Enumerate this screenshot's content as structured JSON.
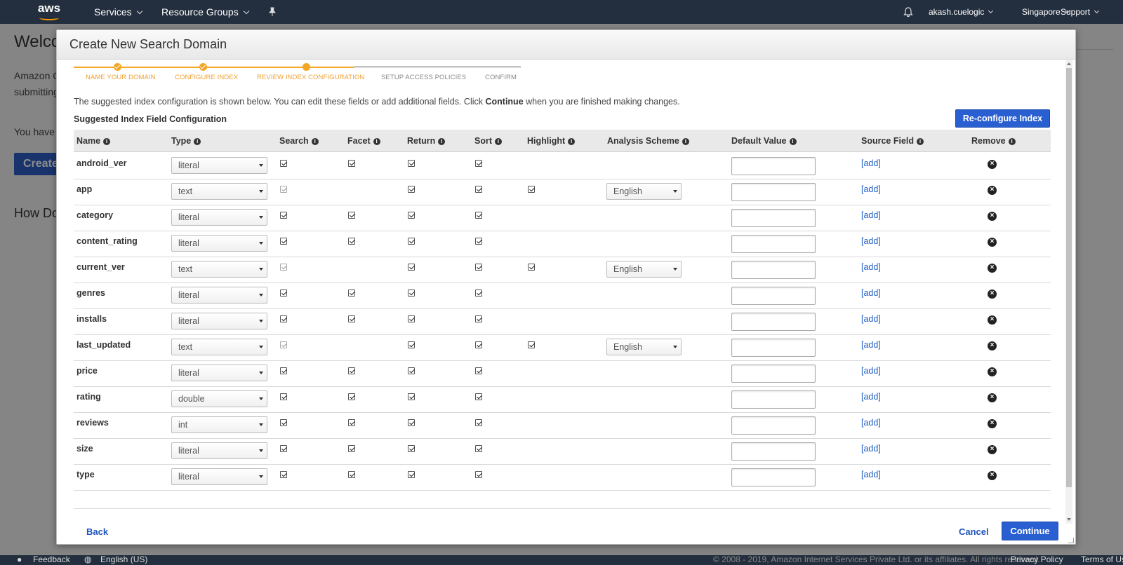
{
  "topnav": {
    "logo_text": "aws",
    "services": "Services",
    "resource_groups": "Resource Groups",
    "user": "akash.cuelogic",
    "region": "Singapore",
    "support": "Support"
  },
  "background": {
    "title": "Welco",
    "line1": "Amazon C",
    "line2": "submitting",
    "line3": "You have",
    "button": "Create",
    "heading": "How Do"
  },
  "footer": {
    "feedback": "Feedback",
    "language": "English (US)",
    "copyright": "© 2008 - 2019, Amazon Internet Services Private Ltd. or its affiliates. All rights reserved.",
    "privacy": "Privacy Policy",
    "terms": "Terms of Use"
  },
  "modal": {
    "title": "Create New Search Domain",
    "steps": [
      {
        "label": "NAME YOUR DOMAIN",
        "state": "done"
      },
      {
        "label": "CONFIGURE INDEX",
        "state": "done"
      },
      {
        "label": "REVIEW INDEX CONFIGURATION",
        "state": "current"
      },
      {
        "label": "SETUP ACCESS POLICIES",
        "state": "todo"
      },
      {
        "label": "CONFIRM",
        "state": "todo"
      }
    ],
    "intro_before": "The suggested index configuration is shown below. You can edit these fields or add additional fields. Click ",
    "intro_bold": "Continue",
    "intro_after": " when you are finished making changes.",
    "section_title": "Suggested Index Field Configuration",
    "reconfigure_button": "Re-configure Index",
    "back": "Back",
    "cancel": "Cancel",
    "continue": "Continue"
  },
  "table": {
    "headers": {
      "name": "Name",
      "type": "Type",
      "search": "Search",
      "facet": "Facet",
      "return": "Return",
      "sort": "Sort",
      "highlight": "Highlight",
      "analysis": "Analysis Scheme",
      "default": "Default Value",
      "source": "Source Field",
      "remove": "Remove"
    },
    "add_label": "[add]",
    "rows": [
      {
        "name": "android_ver",
        "type": "literal",
        "search": true,
        "search_disabled": false,
        "facet": true,
        "return": true,
        "sort": true,
        "highlight": false,
        "analysis": ""
      },
      {
        "name": "app",
        "type": "text",
        "search": true,
        "search_disabled": true,
        "facet": false,
        "return": true,
        "sort": true,
        "highlight": true,
        "analysis": "English"
      },
      {
        "name": "category",
        "type": "literal",
        "search": true,
        "search_disabled": false,
        "facet": true,
        "return": true,
        "sort": true,
        "highlight": false,
        "analysis": ""
      },
      {
        "name": "content_rating",
        "type": "literal",
        "search": true,
        "search_disabled": false,
        "facet": true,
        "return": true,
        "sort": true,
        "highlight": false,
        "analysis": ""
      },
      {
        "name": "current_ver",
        "type": "text",
        "search": true,
        "search_disabled": true,
        "facet": false,
        "return": true,
        "sort": true,
        "highlight": true,
        "analysis": "English"
      },
      {
        "name": "genres",
        "type": "literal",
        "search": true,
        "search_disabled": false,
        "facet": true,
        "return": true,
        "sort": true,
        "highlight": false,
        "analysis": ""
      },
      {
        "name": "installs",
        "type": "literal",
        "search": true,
        "search_disabled": false,
        "facet": true,
        "return": true,
        "sort": true,
        "highlight": false,
        "analysis": ""
      },
      {
        "name": "last_updated",
        "type": "text",
        "search": true,
        "search_disabled": true,
        "facet": false,
        "return": true,
        "sort": true,
        "highlight": true,
        "analysis": "English"
      },
      {
        "name": "price",
        "type": "literal",
        "search": true,
        "search_disabled": false,
        "facet": true,
        "return": true,
        "sort": true,
        "highlight": false,
        "analysis": ""
      },
      {
        "name": "rating",
        "type": "double",
        "search": true,
        "search_disabled": false,
        "facet": true,
        "return": true,
        "sort": true,
        "highlight": false,
        "analysis": ""
      },
      {
        "name": "reviews",
        "type": "int",
        "search": true,
        "search_disabled": false,
        "facet": true,
        "return": true,
        "sort": true,
        "highlight": false,
        "analysis": ""
      },
      {
        "name": "size",
        "type": "literal",
        "search": true,
        "search_disabled": false,
        "facet": true,
        "return": true,
        "sort": true,
        "highlight": false,
        "analysis": ""
      },
      {
        "name": "type",
        "type": "literal",
        "search": true,
        "search_disabled": false,
        "facet": true,
        "return": true,
        "sort": true,
        "highlight": false,
        "analysis": ""
      }
    ]
  },
  "colors": {
    "nav_bg": "#232f3e",
    "accent_orange": "#f5a623",
    "primary_blue": "#2a5fd1",
    "link_blue": "#2360c2"
  }
}
